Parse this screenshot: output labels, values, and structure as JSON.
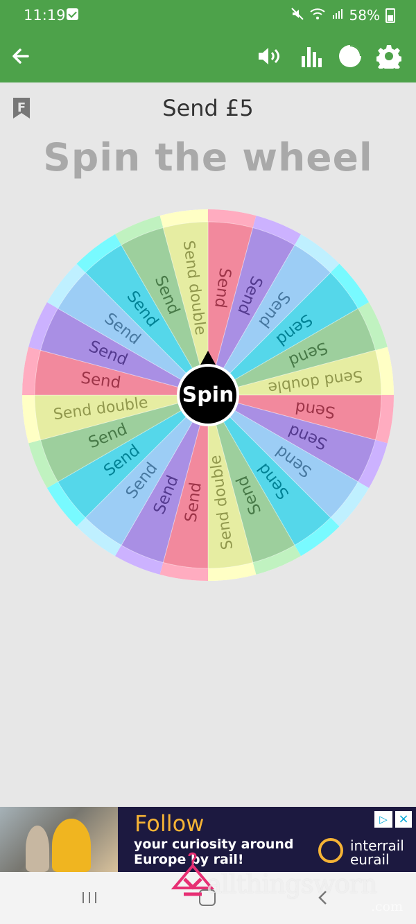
{
  "status_bar": {
    "time": "11:19",
    "battery": "58%",
    "icons": [
      "checkbox-icon",
      "mute-icon",
      "wifi-icon",
      "signal-icon",
      "battery-icon"
    ]
  },
  "app_bar": {
    "icons": [
      "back-arrow-icon",
      "sound-icon",
      "stats-icon",
      "pie-chart-icon",
      "gear-icon"
    ],
    "color": "#4da24a"
  },
  "page": {
    "title": "Send £5",
    "heading": "Spin the wheel",
    "bookmark_letter": "F"
  },
  "wheel": {
    "center_label": "Spin",
    "segments": [
      {
        "label": "Send",
        "color": "#f2899d"
      },
      {
        "label": "Send",
        "color": "#a98fe4"
      },
      {
        "label": "Send",
        "color": "#9ccdf5"
      },
      {
        "label": "Send",
        "color": "#55d7ea"
      },
      {
        "label": "Send",
        "color": "#9dcf9d"
      },
      {
        "label": "Send double",
        "color": "#e6eda2"
      },
      {
        "label": "Send",
        "color": "#f2899d"
      },
      {
        "label": "Send",
        "color": "#a98fe4"
      },
      {
        "label": "Send",
        "color": "#9ccdf5"
      },
      {
        "label": "Send",
        "color": "#55d7ea"
      },
      {
        "label": "Send",
        "color": "#9dcf9d"
      },
      {
        "label": "Send double",
        "color": "#e6eda2"
      },
      {
        "label": "Send",
        "color": "#f2899d"
      },
      {
        "label": "Send",
        "color": "#a98fe4"
      },
      {
        "label": "Send",
        "color": "#9ccdf5"
      },
      {
        "label": "Send",
        "color": "#55d7ea"
      },
      {
        "label": "Send",
        "color": "#9dcf9d"
      },
      {
        "label": "Send double",
        "color": "#e6eda2"
      },
      {
        "label": "Send",
        "color": "#f2899d"
      },
      {
        "label": "Send",
        "color": "#a98fe4"
      },
      {
        "label": "Send",
        "color": "#9ccdf5"
      },
      {
        "label": "Send",
        "color": "#55d7ea"
      },
      {
        "label": "Send",
        "color": "#9dcf9d"
      },
      {
        "label": "Send double",
        "color": "#e6eda2"
      }
    ]
  },
  "ad": {
    "headline": "Follow",
    "line1": "your curiosity around",
    "line2": "Europe by rail!",
    "brand1": "interrail",
    "brand2": "eurail",
    "info_icon": "ad-info-icon",
    "close_icon": "close-icon"
  },
  "nav_bar": {
    "icons": [
      "recents-icon",
      "home-icon",
      "back-icon"
    ]
  },
  "watermark": {
    "text": "allthingsworn",
    "suffix": ".com"
  }
}
